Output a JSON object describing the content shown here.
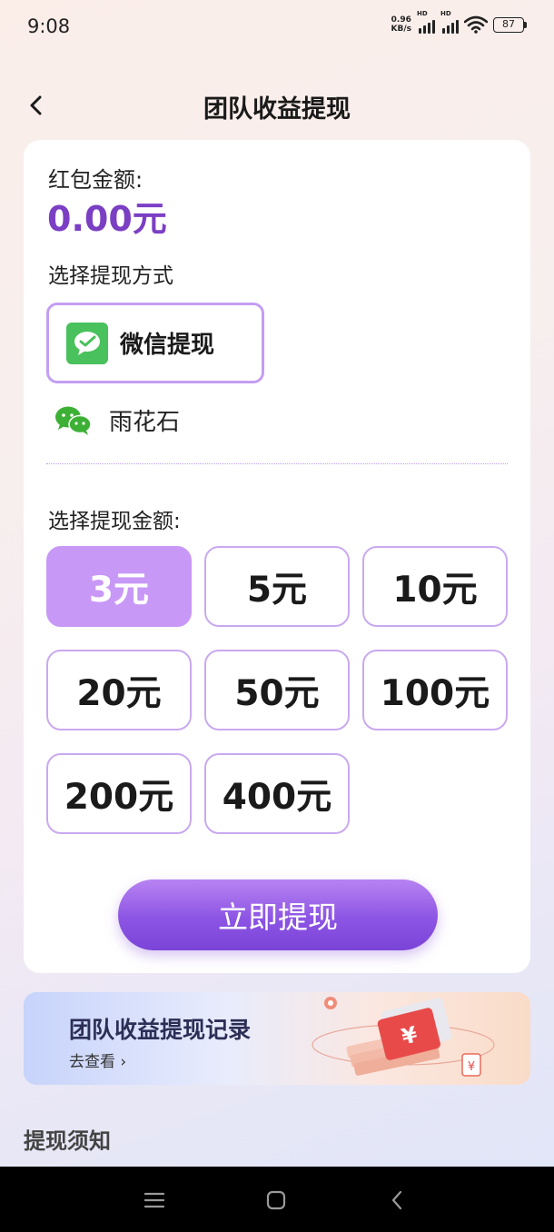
{
  "status_bar": {
    "time": "9:08",
    "net_speed_value": "0.96",
    "net_speed_unit": "KB/s",
    "signal_label": "HD",
    "battery": "87"
  },
  "nav": {
    "title": "团队收益提现"
  },
  "card": {
    "amount_label": "红包金额:",
    "amount_value": "0.00元",
    "method_label": "选择提现方式",
    "method_button": "微信提现",
    "account_name": "雨花石",
    "select_amount_label": "选择提现金额:",
    "amount_options": [
      {
        "label": "3元",
        "selected": true
      },
      {
        "label": "5元",
        "selected": false
      },
      {
        "label": "10元",
        "selected": false
      },
      {
        "label": "20元",
        "selected": false
      },
      {
        "label": "50元",
        "selected": false
      },
      {
        "label": "100元",
        "selected": false
      },
      {
        "label": "200元",
        "selected": false
      },
      {
        "label": "400元",
        "selected": false
      }
    ],
    "withdraw_button": "立即提现"
  },
  "record": {
    "title": "团队收益提现记录",
    "link": "去查看 ›"
  },
  "notice": {
    "title": "提现须知"
  },
  "colors": {
    "accent": "#7b3fc4",
    "selected_option": "#c898f7",
    "wechat_green": "#49c15d"
  },
  "icons": [
    "back-arrow-icon",
    "wechat-icon",
    "wechat-logo-icon",
    "menu-icon",
    "home-icon",
    "back-icon",
    "wifi-icon",
    "signal-icon",
    "battery-icon"
  ]
}
